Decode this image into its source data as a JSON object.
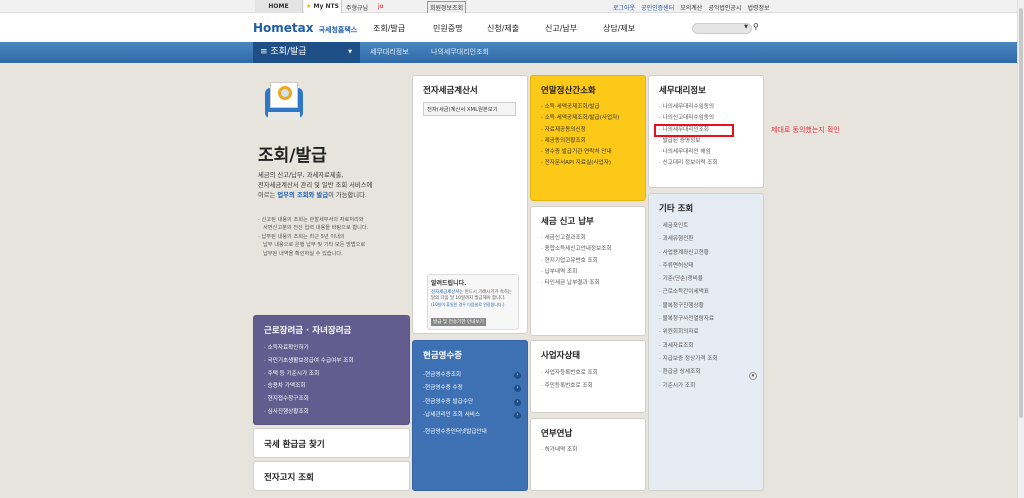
{
  "topbar": {
    "home": "HOME",
    "mynts": "My NTS",
    "user": "주형규님",
    "user_id": "ju",
    "member_info": "회원정보조회",
    "links": [
      "로그아웃",
      "공인인증센터",
      "모의계산",
      "공익법인공시",
      "법령정보"
    ]
  },
  "header": {
    "logo_main": "Hometax",
    "logo_sub": "국세청홈택스",
    "menu": [
      "조회/발급",
      "민원증명",
      "신청/제출",
      "신고/납부",
      "상담/제보"
    ]
  },
  "nav": {
    "current": "조회/발급",
    "crumbs": [
      "세무대리정보",
      "나의세무대리인조회"
    ]
  },
  "intro": {
    "title": "조회/발급",
    "desc1": "세금의 신고/납부, 과세자료제출,",
    "desc2": "전자세금계산서 관리 및 일반 조회 서비스에",
    "desc3_pre": "이르는 ",
    "desc3_hl": "업무의 조회와 발급",
    "desc3_post": "이 가능합니다.",
    "note1a": "- 신고된 내용의 조회는 관할세무서의 자료처리와",
    "note1b": "서면신고분의 전산 입력 내용을 바탕으로 합니다.",
    "note2a": "- 납부된 내용의 조회는 최근 5년 이내의",
    "note2b": "납부 내용으로 은행 납부 및 기타 모든 방법으로",
    "note2c": "납부된 내역을 확인하실 수 있습니다."
  },
  "etax": {
    "title": "전자세금계산서",
    "button": "전자(세금)계산서 XML원본보기",
    "notice_title": "알려드립니다.",
    "notice_hl": "전자세금계산서",
    "notice_text": "는 반드시 거래시기가 속하는 달의 다음 달 10일까지 발급해야 합니다.",
    "notice_small": "(10일이 휴일인 경우 다음날로 연장됩니다.)",
    "notice_button": "발급 및 전송기한 안내보기"
  },
  "yearend": {
    "title": "연말정산간소화",
    "items": [
      "소득·세액공제조회/발급",
      "소득·세액공제조회/발급(사업자)",
      "자료제공동의신청",
      "제공동의현황조회",
      "영수증 발급기관 연락처 안내",
      "전자문서API 자료실(사업자)"
    ]
  },
  "agent": {
    "title": "세무대리정보",
    "items": [
      "나의세무대리수임동의",
      "나의신고대리수임동의",
      "나의세무대리인조회",
      "발급된 증명정보",
      "나의세무대리인 해임",
      "신고대리 정보이력 조회"
    ]
  },
  "annotation": "제대로 동의했는지 확인",
  "taxreport": {
    "title": "세금 신고 납부",
    "items": [
      "세금신고결과조회",
      "종합소득세신고안내정보조회",
      "현지기업고유번호 조회",
      "납부내역 조회",
      "타인세금 납부결과 조회"
    ]
  },
  "other": {
    "title": "기타 조회",
    "items": [
      "세금포인트",
      "과세유형전환",
      "사업용계좌신고현황",
      "주류면허상태",
      "기준(단순)경비율",
      "근로소득간이세액표",
      "불복청구진행상황",
      "불복청구사전열람자료",
      "위원회회의자료",
      "과세자료조회",
      "지급보증 정상가격 조회",
      "환급금 상세조회",
      "기준시가 조회"
    ]
  },
  "eitc": {
    "title": "근로장려금 · 자녀장려금",
    "items": [
      "소득자료확인하기",
      "국민기초생활보장급여 수급여부 조회",
      "주택 등 기준시가 조회",
      "승용차 가액조회",
      "현지접수창구조회",
      "심사진행상황조회"
    ]
  },
  "refund": {
    "title": "국세 환급금 찾기"
  },
  "ebill": {
    "title": "전자고지 조회"
  },
  "cash": {
    "title": "현금영수증",
    "items": [
      "현금영수증조회",
      "현금영수증 수정",
      "현금영수증 발급수단",
      "납세관리인 조회 서비스"
    ],
    "extra": "현금영수증인터넷발급안내"
  },
  "biz": {
    "title": "사업자상태",
    "items": [
      "사업자등록번호로 조회",
      "주민등록번호로 조회"
    ]
  },
  "installment": {
    "title": "연부연납",
    "items": [
      "허가내역 조회"
    ]
  }
}
